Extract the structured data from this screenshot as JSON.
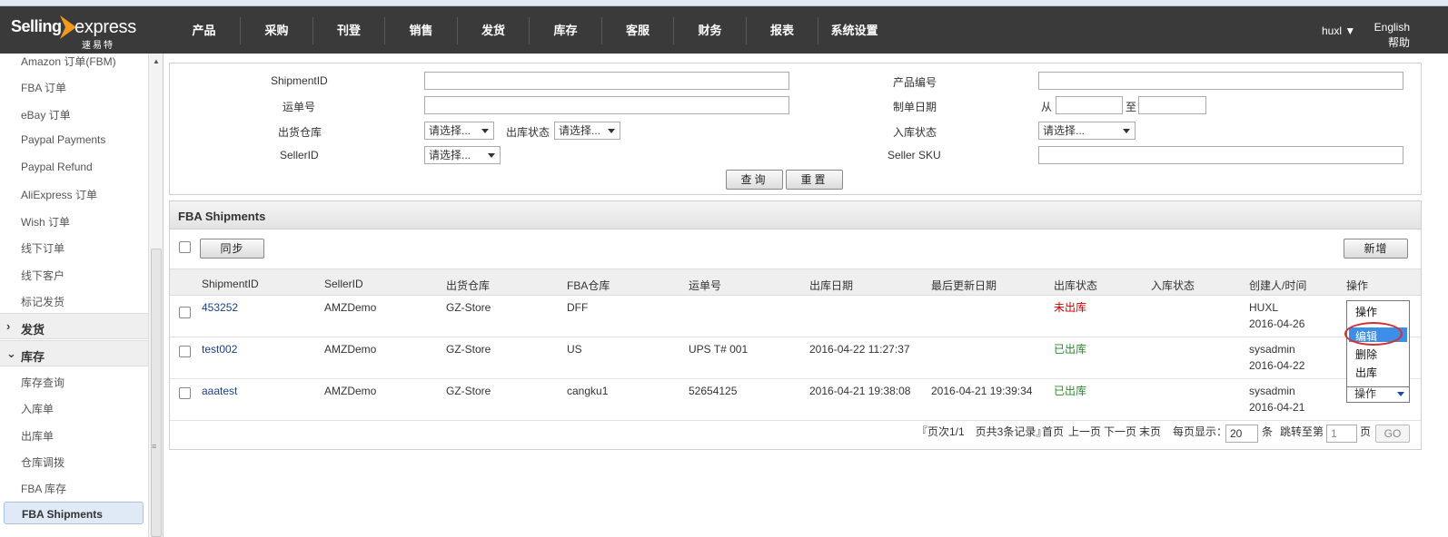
{
  "header": {
    "logo_selling": "Selling",
    "logo_express": "express",
    "logo_cn": "速易特",
    "nav": [
      "产品",
      "采购",
      "刊登",
      "销售",
      "发货",
      "库存",
      "客服",
      "财务",
      "报表",
      "系统设置"
    ],
    "user": "huxl ▼",
    "language": "English",
    "help": "帮助"
  },
  "sidebar": {
    "items_top": [
      "Amazon 订单(FBM)",
      "FBA 订单",
      "eBay 订单",
      "Paypal Payments",
      "Paypal Refund",
      "AliExpress 订单",
      "Wish 订单",
      "线下订单",
      "线下客户",
      "标记发货"
    ],
    "section_ship": "发货",
    "section_stock": "库存",
    "items_stock": [
      "库存查询",
      "入库单",
      "出库单",
      "仓库调拨",
      "FBA 库存"
    ],
    "active": "FBA Shipments"
  },
  "search": {
    "shipment_id_label": "ShipmentID",
    "product_no_label": "产品编号",
    "waybill_label": "运单号",
    "create_date_label": "制单日期",
    "from_label": "从",
    "to_label": "至",
    "out_warehouse_label": "出货仓库",
    "out_warehouse_value": "请选择...",
    "out_status_label": "出库状态",
    "out_status_value": "请选择...",
    "in_status_label": "入库状态",
    "in_status_value": "请选择...",
    "seller_id_label": "SellerID",
    "seller_id_value": "请选择...",
    "seller_sku_label": "Seller SKU",
    "query_button": "查询",
    "reset_button": "重置"
  },
  "list": {
    "title": "FBA Shipments",
    "sync_button": "同步",
    "new_button": "新增",
    "columns": [
      "ShipmentID",
      "SellerID",
      "出货仓库",
      "FBA仓库",
      "运单号",
      "出库日期",
      "最后更新日期",
      "出库状态",
      "入库状态",
      "创建人/时间",
      "操作"
    ],
    "rows": [
      {
        "shipment_id": "453252",
        "seller_id": "AMZDemo",
        "warehouse": "GZ-Store",
        "fba_warehouse": "DFF",
        "waybill": "",
        "out_date": "",
        "updated": "",
        "out_status": "未出库",
        "in_status": "",
        "creator": "HUXL",
        "created": "2016-04-26",
        "op": "操作"
      },
      {
        "shipment_id": "test002",
        "seller_id": "AMZDemo",
        "warehouse": "GZ-Store",
        "fba_warehouse": "US",
        "waybill": "UPS T# 001",
        "out_date": "2016-04-22 11:27:37",
        "updated": "",
        "out_status": "已出库",
        "in_status": "",
        "creator": "sysadmin",
        "created": "2016-04-22",
        "op": ""
      },
      {
        "shipment_id": "aaatest",
        "seller_id": "AMZDemo",
        "warehouse": "GZ-Store",
        "fba_warehouse": "cangku1",
        "waybill": "52654125",
        "out_date": "2016-04-21 19:38:08",
        "updated": "2016-04-21 19:39:34",
        "out_status": "已出库",
        "in_status": "",
        "creator": "sysadmin",
        "created": "2016-04-21",
        "op": "操作"
      }
    ],
    "dropdown_options": [
      "操作",
      "编辑",
      "删除",
      "出库"
    ],
    "dropdown_selected": "编辑"
  },
  "pager": {
    "summary": "『页次1/1　页共3条记录』",
    "first": "首页",
    "prev": "上一页",
    "next": "下一页",
    "last": "末页",
    "per_page_label": "每页显示：",
    "per_page_value": "20",
    "per_page_unit": "条",
    "jump_label": "跳转至第",
    "jump_value": "1",
    "jump_unit": "页",
    "go": "GO"
  },
  "colors": {
    "header_bg": "#3a3a3a",
    "link": "#1a3f8b",
    "status_not_out": "#cc0000",
    "status_out": "#2a8a2a",
    "highlight": "#3d8ee8",
    "circle": "#d43030"
  }
}
